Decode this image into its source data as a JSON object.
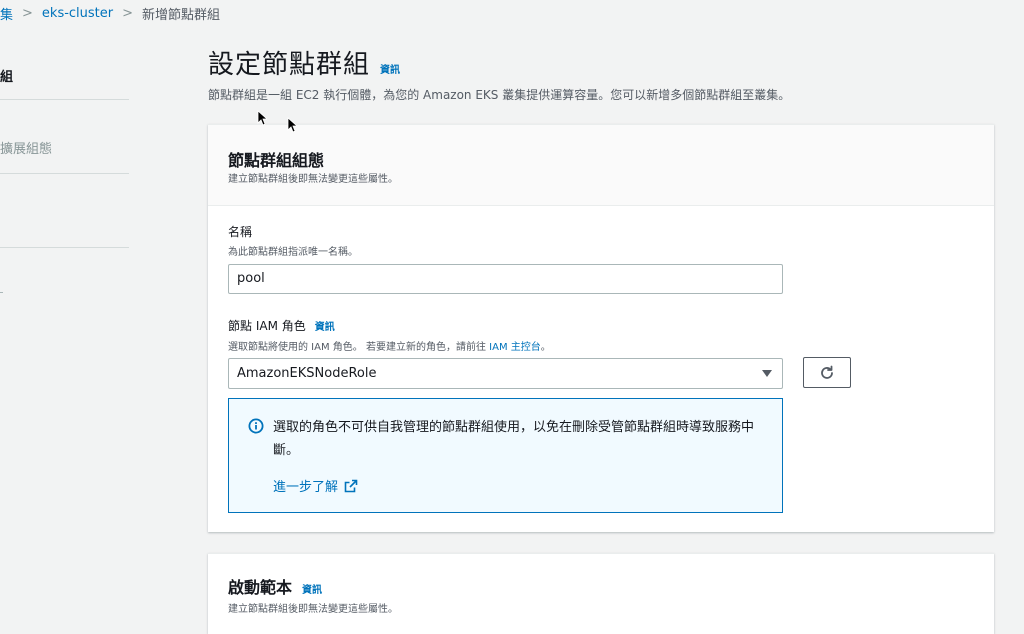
{
  "breadcrumb": {
    "items": [
      "集",
      "eks-cluster"
    ],
    "current": "新增節點群組"
  },
  "sidebar": {
    "items": [
      "組",
      "擴展組態"
    ]
  },
  "page": {
    "title": "設定節點群組",
    "info_label": "資訊",
    "description": "節點群組是一組 EC2 執行個體，為您的 Amazon EKS 叢集提供運算容量。您可以新增多個節點群組至叢集。"
  },
  "node_group_config": {
    "title": "節點群組組態",
    "subtitle": "建立節點群組後即無法變更這些屬性。",
    "name_field": {
      "label": "名稱",
      "description": "為此節點群組指派唯一名稱。",
      "value": "pool"
    },
    "iam_role_field": {
      "label": "節點 IAM 角色",
      "info_label": "資訊",
      "description_prefix": "選取節點將使用的 IAM 角色。 若要建立新的角色，請前往",
      "description_link": "IAM 主控台",
      "description_suffix": "。",
      "selected_value": "AmazonEKSNodeRole"
    },
    "alert": {
      "text": "選取的角色不可供自我管理的節點群組使用，以免在刪除受管節點群組時導致服務中斷。",
      "link": "進一步了解"
    }
  },
  "launch_template": {
    "title": "啟動範本",
    "info_label": "資訊",
    "subtitle": "建立節點群組後即無法變更這些屬性。"
  },
  "colors": {
    "link": "#0073bb",
    "alert_bg": "#f1faff",
    "alert_border": "#0073bb",
    "page_bg": "#f2f3f3"
  },
  "icons": {
    "refresh": "refresh-icon",
    "info": "info-circle-icon",
    "external": "external-link-icon",
    "select": "caret-down-icon"
  }
}
